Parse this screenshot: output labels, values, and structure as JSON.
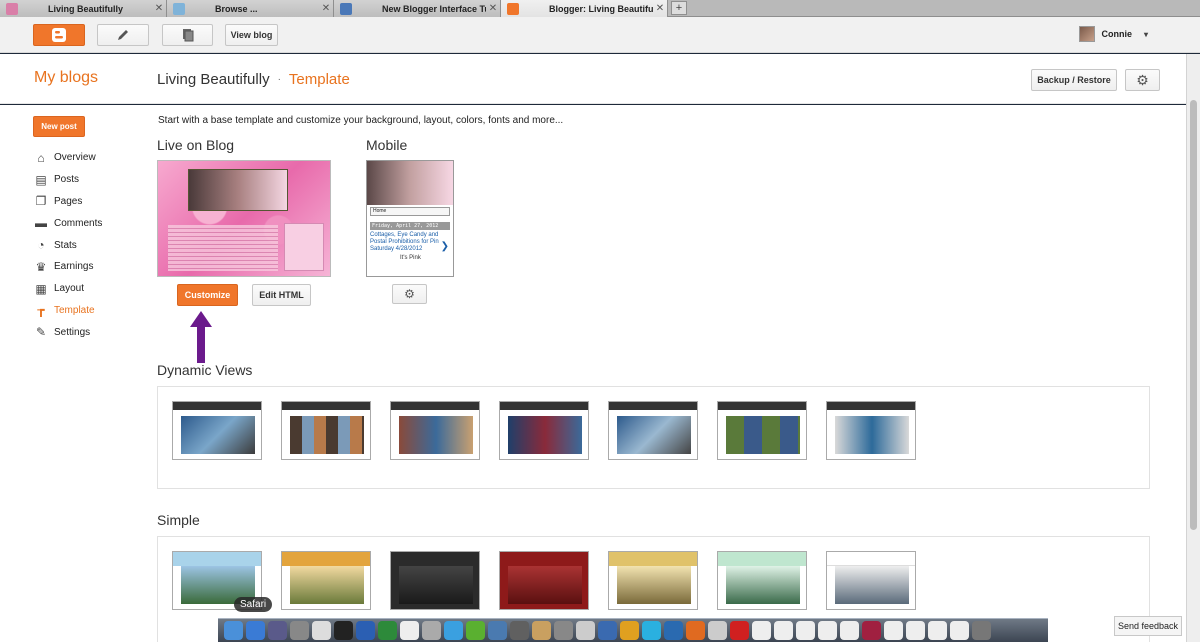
{
  "browser": {
    "tabs": [
      {
        "title": "Living Beautifully",
        "favicon": "#d97fa8",
        "active": false
      },
      {
        "title": "Browse ...",
        "favicon": "#7fb3d9",
        "active": false
      },
      {
        "title": "New Blogger Interface Tutorial ...",
        "favicon": "#4a78b8",
        "active": false
      },
      {
        "title": "Blogger: Living Beautifully – Te...",
        "favicon": "#f0762b",
        "active": true
      }
    ],
    "new_tab_label": "+",
    "close_glyph": "✕"
  },
  "topbar": {
    "view_blog_label": "View blog",
    "user_name": "Connie",
    "caret": "▾"
  },
  "header": {
    "my_blogs": "My blogs",
    "blog_name": "Living Beautifully",
    "separator": "·",
    "page": "Template",
    "backup_label": "Backup / Restore",
    "gear_glyph": "⚙"
  },
  "sidebar": {
    "new_post_label": "New post",
    "items": [
      {
        "label": "Overview",
        "icon": "home-icon",
        "glyph": "⌂",
        "active": false
      },
      {
        "label": "Posts",
        "icon": "posts-icon",
        "glyph": "▤",
        "active": false
      },
      {
        "label": "Pages",
        "icon": "pages-icon",
        "glyph": "❐",
        "active": false
      },
      {
        "label": "Comments",
        "icon": "comments-icon",
        "glyph": "▬",
        "active": false
      },
      {
        "label": "Stats",
        "icon": "stats-icon",
        "glyph": "◔",
        "active": false
      },
      {
        "label": "Earnings",
        "icon": "trophy-icon",
        "glyph": "♛",
        "active": false
      },
      {
        "label": "Layout",
        "icon": "layout-icon",
        "glyph": "▦",
        "active": false
      },
      {
        "label": "Template",
        "icon": "template-icon",
        "glyph": "┲",
        "active": true
      },
      {
        "label": "Settings",
        "icon": "wrench-icon",
        "glyph": "✎",
        "active": false
      }
    ]
  },
  "main": {
    "intro": "Start with a base template and customize your background, layout, colors, fonts and more...",
    "live_title": "Live on Blog",
    "mobile_title": "Mobile",
    "customize_label": "Customize",
    "edit_html_label": "Edit HTML",
    "mobile_preview": {
      "select": "Home",
      "date": "Friday, April 27, 2012",
      "post_title": "Cottages, Eye Candy and Postal Prohibitions for Pin Saturday 4/28/2012",
      "byline": "It's Pink",
      "arrow": "❯"
    },
    "dynamic_title": "Dynamic Views",
    "simple_title": "Simple",
    "dynamic_count": 7,
    "simple_count": 7,
    "simple_colors": [
      "#a9d3ea",
      "#e3a43d",
      "#2b2b2b",
      "#8e1a1a",
      "#e0c26a",
      "#bfe6cf",
      "#ffffff"
    ]
  },
  "overlay": {
    "tooltip": "Safari",
    "send_feedback": "Send feedback"
  },
  "accent": "#e8731f"
}
